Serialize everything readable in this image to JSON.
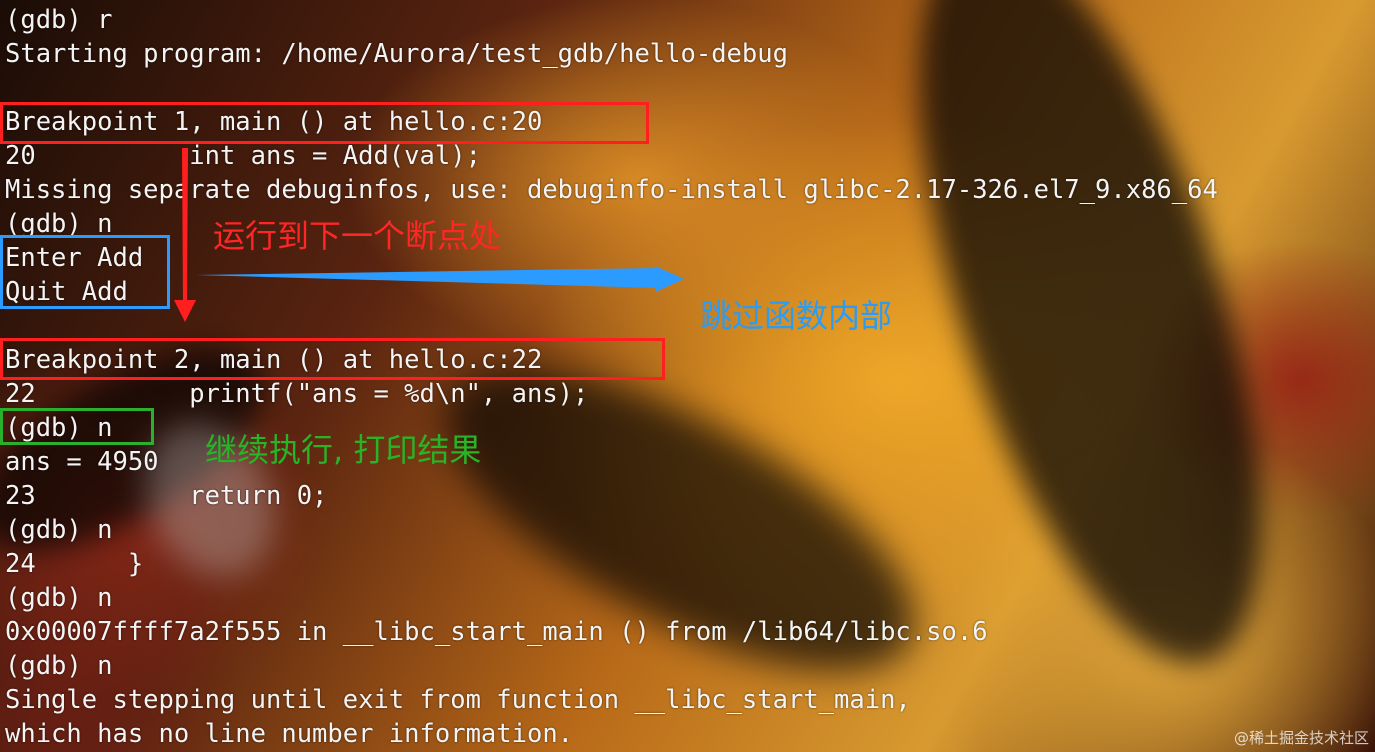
{
  "terminal": {
    "lines": [
      "(gdb) r",
      "Starting program: /home/Aurora/test_gdb/hello-debug",
      "",
      "Breakpoint 1, main () at hello.c:20",
      "20          int ans = Add(val);",
      "Missing separate debuginfos, use: debuginfo-install glibc-2.17-326.el7_9.x86_64",
      "(gdb) n",
      "Enter Add",
      "Quit Add",
      "",
      "Breakpoint 2, main () at hello.c:22",
      "22          printf(\"ans = %d\\n\", ans);",
      "(gdb) n",
      "ans = 4950",
      "23          return 0;",
      "(gdb) n",
      "24      }",
      "(gdb) n",
      "0x00007ffff7a2f555 in __libc_start_main () from /lib64/libc.so.6",
      "(gdb) n",
      "Single stepping until exit from function __libc_start_main,",
      "which has no line number information."
    ]
  },
  "annotations": {
    "red_note": "运行到下一个断点处",
    "blue_note": "跳过函数内部",
    "green_note": "继续执行, 打印结果"
  },
  "colors": {
    "red": "#ff1f1f",
    "blue": "#2b9bff",
    "green": "#2ab02a",
    "terminal_text": "#f4f4f4"
  },
  "watermark": "@稀土掘金技术社区"
}
